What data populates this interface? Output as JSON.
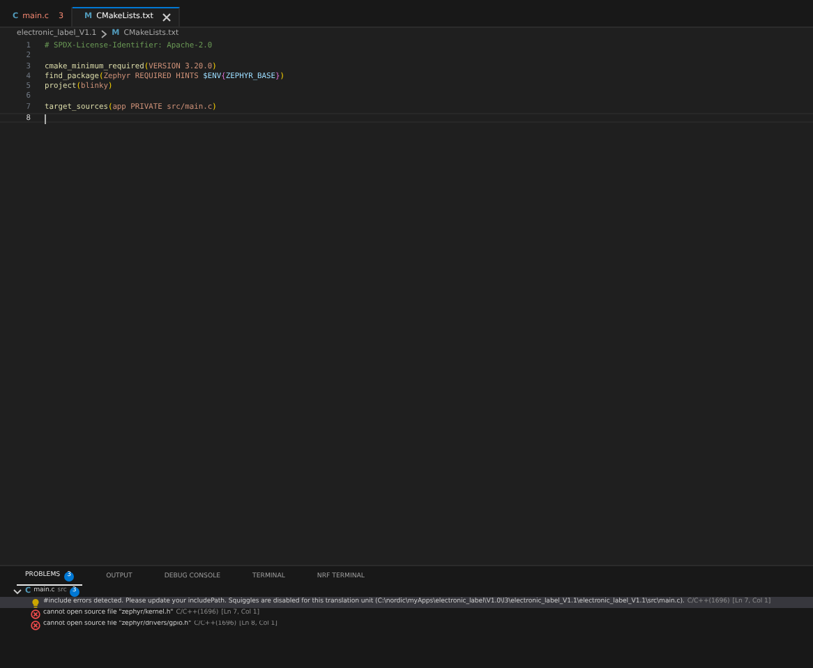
{
  "tabs": [
    {
      "icon": "C",
      "label": "main.c",
      "badge": "3",
      "selected": false,
      "has_errors": true
    },
    {
      "icon": "M",
      "label": "CMakeLists.txt",
      "selected": true,
      "has_errors": false
    }
  ],
  "breadcrumb": {
    "folder": "electronic_label_V1.1",
    "file_icon": "M",
    "file": "CMakeLists.txt"
  },
  "editor": {
    "lines": [
      {
        "number": "1",
        "tokens": [
          {
            "kind": "comment",
            "text": "# SPDX-License-Identifier: Apache-2.0"
          }
        ]
      },
      {
        "number": "2"
      },
      {
        "number": "3",
        "tokens": [
          {
            "kind": "func",
            "text": "cmake_minimum_required"
          },
          {
            "kind": "bracket",
            "text": "("
          },
          {
            "kind": "plain",
            "text": "VERSION 3.20.0"
          },
          {
            "kind": "bracket",
            "text": ")"
          }
        ]
      },
      {
        "number": "4",
        "tokens": [
          {
            "kind": "func",
            "text": "find_package"
          },
          {
            "kind": "bracket",
            "text": "("
          },
          {
            "kind": "plain",
            "text": "Zephyr REQUIRED HINTS "
          },
          {
            "kind": "var",
            "text": "$ENV"
          },
          {
            "kind": "bracket2",
            "text": "{"
          },
          {
            "kind": "var",
            "text": "ZEPHYR_BASE"
          },
          {
            "kind": "bracket2",
            "text": "}"
          },
          {
            "kind": "bracket",
            "text": ")"
          }
        ]
      },
      {
        "number": "5",
        "tokens": [
          {
            "kind": "func",
            "text": "project"
          },
          {
            "kind": "bracket",
            "text": "("
          },
          {
            "kind": "plain",
            "text": "blinky"
          },
          {
            "kind": "bracket",
            "text": ")"
          }
        ]
      },
      {
        "number": "6"
      },
      {
        "number": "7",
        "tokens": [
          {
            "kind": "func",
            "text": "target_sources"
          },
          {
            "kind": "bracket",
            "text": "("
          },
          {
            "kind": "plain",
            "text": "app PRIVATE src/main.c"
          },
          {
            "kind": "bracket",
            "text": ")"
          }
        ]
      },
      {
        "number": "8",
        "current": true
      }
    ]
  },
  "panel": {
    "tabs": [
      {
        "label": "PROBLEMS",
        "badge": "3",
        "selected": true
      },
      {
        "label": "OUTPUT",
        "selected": false
      },
      {
        "label": "DEBUG CONSOLE",
        "selected": false
      },
      {
        "label": "TERMINAL",
        "selected": false
      },
      {
        "label": "NRF TERMINAL",
        "selected": false
      }
    ],
    "group": {
      "icon": "C",
      "file": "main.c",
      "folder": "src",
      "count": "3",
      "expanded": true
    },
    "problems": [
      {
        "kind": "info",
        "message": "#include errors detected. Please update your includePath. Squiggles are disabled for this translation unit (C:\\nordic\\myApps\\electronic_label\\V1.0\\l3\\electronic_label_V1.1\\electronic_label_V1.1\\src\\main.c).",
        "source": "C/C++(1696)",
        "location": "[Ln 7, Col 1]",
        "selected": true
      },
      {
        "kind": "error",
        "message": "cannot open source file \"zephyr/kernel.h\"",
        "source": "C/C++(1696)",
        "location": "[Ln 7, Col 1]",
        "selected": false
      },
      {
        "kind": "error",
        "message": "cannot open source file \"zephyr/drivers/gpio.h\"",
        "source": "C/C++(1696)",
        "location": "[Ln 8, Col 1]",
        "selected": false
      }
    ]
  }
}
